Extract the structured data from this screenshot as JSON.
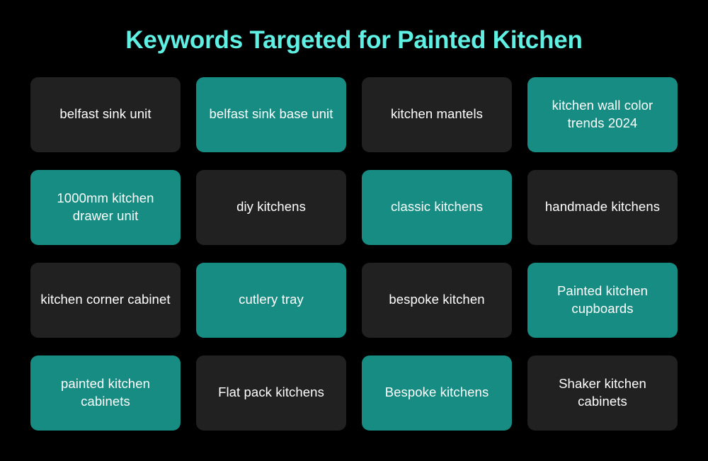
{
  "header": {
    "title": "Keywords Targeted for Painted Kitchen",
    "title_color": "#5FF0E3"
  },
  "theme": {
    "background": "#000000",
    "card_dark": "#212121",
    "card_teal": "#178C82",
    "card_text": "#FFFFFF",
    "accent": "#5FF0E3"
  },
  "grid": {
    "columns": 4,
    "rows": 4,
    "cards": [
      {
        "label": "belfast sink unit",
        "style": "dark"
      },
      {
        "label": "belfast sink base unit",
        "style": "teal"
      },
      {
        "label": "kitchen mantels",
        "style": "dark"
      },
      {
        "label": "kitchen wall color trends 2024",
        "style": "teal"
      },
      {
        "label": "1000mm kitchen drawer unit",
        "style": "teal"
      },
      {
        "label": "diy kitchens",
        "style": "dark"
      },
      {
        "label": "classic kitchens",
        "style": "teal"
      },
      {
        "label": "handmade kitchens",
        "style": "dark"
      },
      {
        "label": "kitchen corner cabinet",
        "style": "dark"
      },
      {
        "label": "cutlery tray",
        "style": "teal"
      },
      {
        "label": "bespoke kitchen",
        "style": "dark"
      },
      {
        "label": "Painted kitchen cupboards",
        "style": "teal"
      },
      {
        "label": "painted kitchen cabinets",
        "style": "teal"
      },
      {
        "label": "Flat pack kitchens",
        "style": "dark"
      },
      {
        "label": "Bespoke kitchens",
        "style": "teal"
      },
      {
        "label": "Shaker kitchen cabinets",
        "style": "dark"
      }
    ]
  }
}
